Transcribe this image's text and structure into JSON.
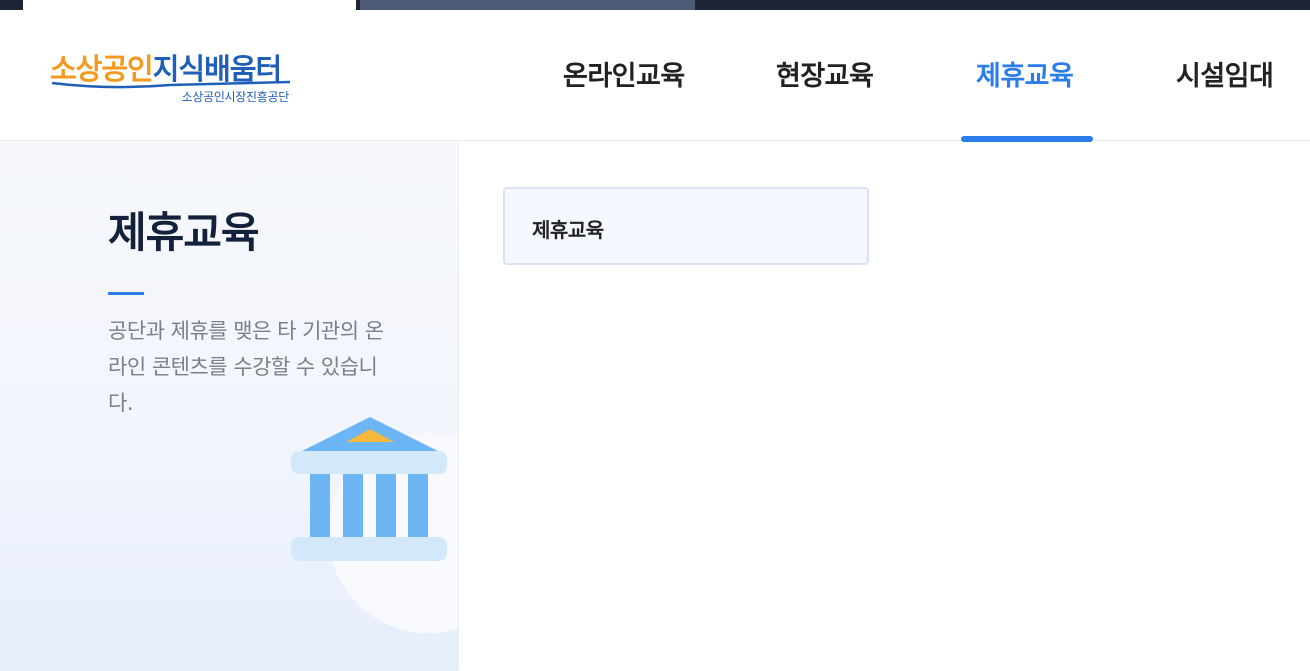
{
  "logo": {
    "brand_part1": "소상공인",
    "brand_part2": "지식배움터",
    "subtitle": "소상공인시장진흥공단"
  },
  "nav": {
    "items": [
      {
        "label": "온라인교육"
      },
      {
        "label": "현장교육"
      },
      {
        "label": "제휴교육"
      },
      {
        "label": "시설임대"
      }
    ],
    "active_index": 2
  },
  "sidebar": {
    "title": "제휴교육",
    "description": "공단과 제휴를 맺은 타 기관의 온라인 콘텐츠를 수강할 수 있습니다.",
    "illustration_icon": "institution-building-icon"
  },
  "content": {
    "tabs": [
      {
        "label": "제휴교육"
      }
    ]
  },
  "colors": {
    "accent": "#2b7de9",
    "brand_orange": "#f39a1e",
    "brand_blue": "#1f5fb8",
    "topbar": "#1e2535"
  }
}
